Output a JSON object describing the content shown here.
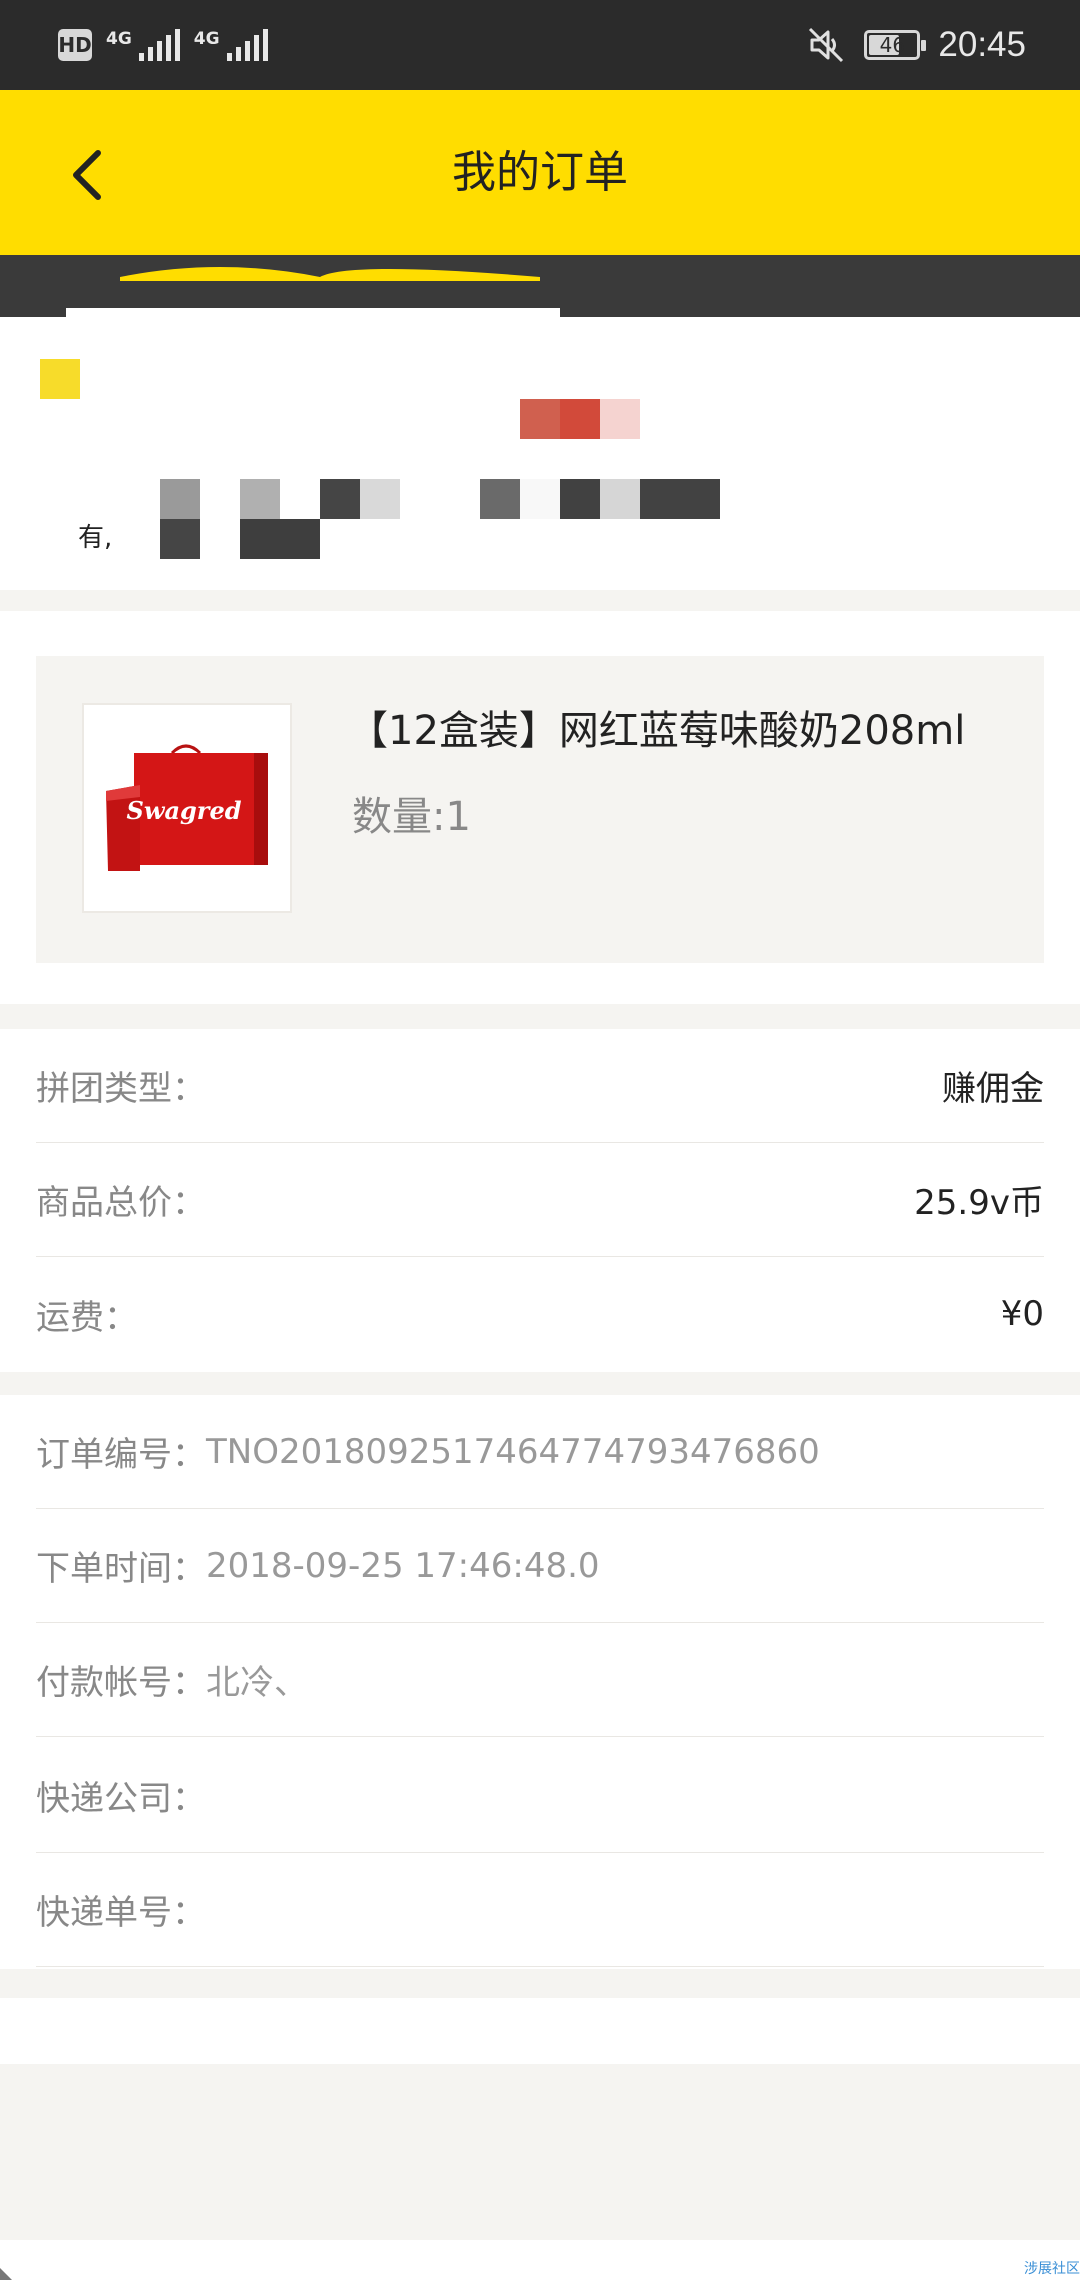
{
  "status_bar": {
    "hd_label": "HD",
    "signal1_label": "4G",
    "signal2_label": "4G",
    "battery_level": "46",
    "time": "20:45"
  },
  "header": {
    "title": "我的订单",
    "back_icon": "chevron-left-icon"
  },
  "address": {
    "prefix_text": "有,"
  },
  "product": {
    "name": "【12盒装】网红蓝莓味酸奶208ml",
    "quantity": "数量:1",
    "brand_on_box": "Swagred"
  },
  "order_summary": {
    "rows": [
      {
        "label": "拼团类型：",
        "value": "赚佣金"
      },
      {
        "label": "商品总价：",
        "value": "25.9v币"
      },
      {
        "label": "运费：",
        "value": "¥0"
      }
    ]
  },
  "order_details": {
    "rows": [
      {
        "label": "订单编号：",
        "value": "TNO20180925174647747934768​60"
      },
      {
        "label": "下单时间：",
        "value": "2018-09-25 17:46:48.0"
      },
      {
        "label": "付款帐号：",
        "value": "北冷、"
      },
      {
        "label": "快递公司：",
        "value": ""
      },
      {
        "label": "快递单号：",
        "value": ""
      }
    ]
  },
  "footer": {
    "watermark": "涉展社区"
  },
  "colors": {
    "accent": "#ffdd00",
    "status_bar": "#2b2b2b",
    "background": "#f5f4f1"
  }
}
